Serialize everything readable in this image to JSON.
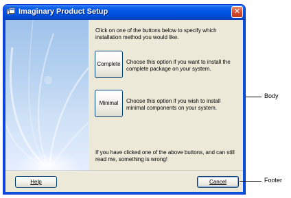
{
  "window": {
    "title": "Imaginary Product Setup",
    "close_glyph": "✕"
  },
  "body": {
    "intro": "Click on one of the buttons below to specify which installation method you would like.",
    "options": [
      {
        "button_label": "Complete",
        "description": "Choose this option if you want to install the complete package on your system."
      },
      {
        "button_label": "Minimal",
        "description": "Choose this option if you wish to install minimal components on your system."
      }
    ],
    "warning": "If you have clicked one of the above buttons, and can still read me, something is wrong!"
  },
  "footer": {
    "help_label": "Help",
    "cancel_label": "Cancel"
  },
  "callouts": {
    "body": "Body",
    "footer": "Footer"
  },
  "icons": {
    "app": "setup-app-icon",
    "close": "close-icon"
  },
  "colors": {
    "titlebar": "#0054e3",
    "dialog_face": "#ece9d8",
    "close_button": "#d4472a",
    "button_border": "#003c74"
  }
}
